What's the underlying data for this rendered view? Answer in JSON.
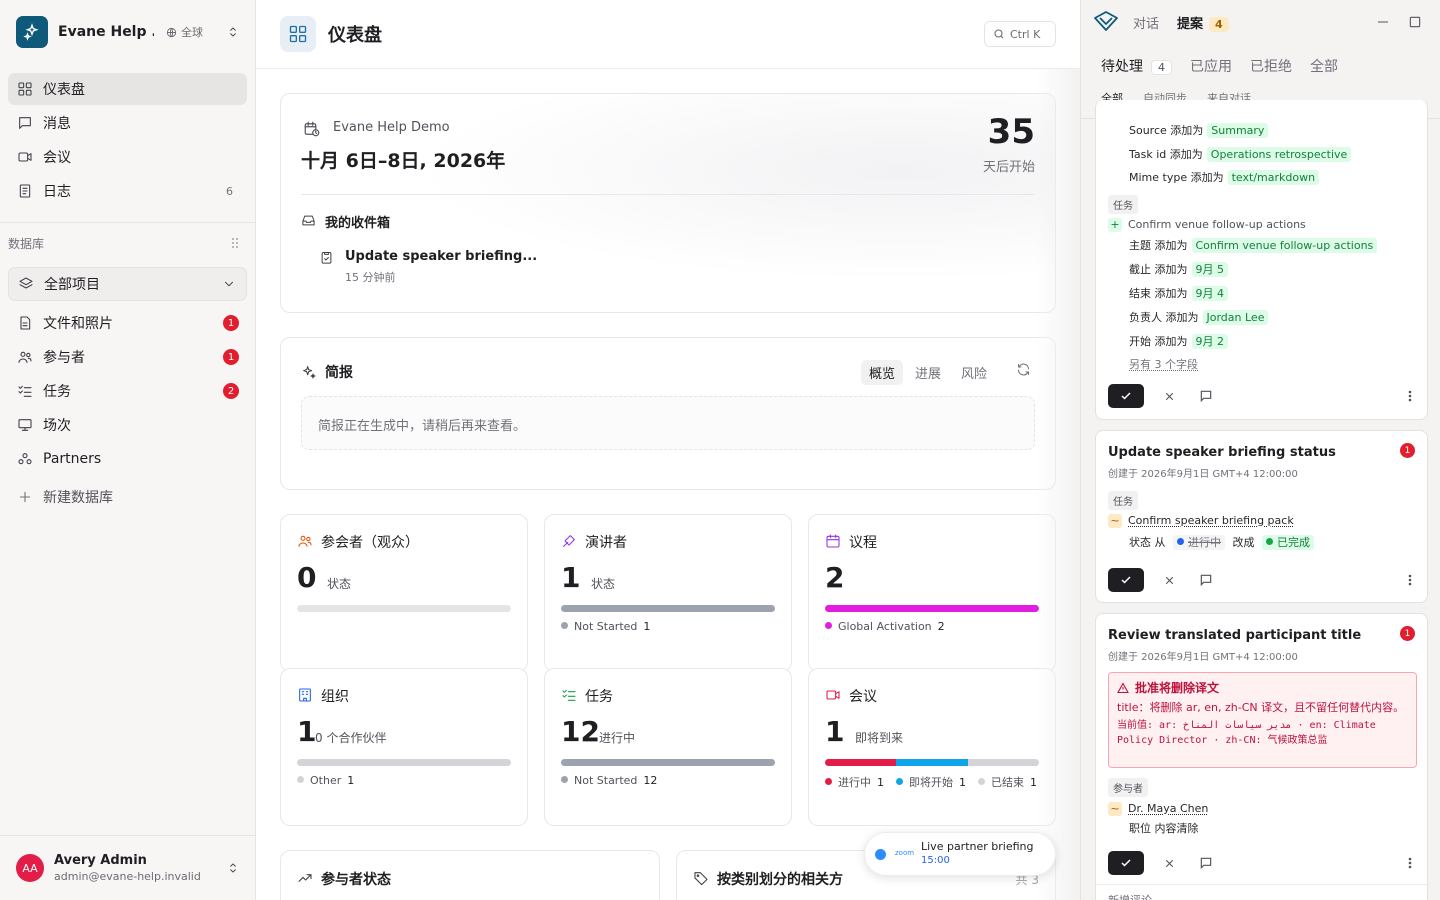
{
  "workspace": {
    "name": "Evane Help ...",
    "scope": "全球"
  },
  "nav": [
    {
      "label": "仪表盘"
    },
    {
      "label": "消息"
    },
    {
      "label": "会议"
    },
    {
      "label": "日志",
      "count": "6"
    }
  ],
  "database": {
    "section_title": "数据库",
    "all_projects": "全部项目",
    "items": [
      {
        "label": "文件和照片",
        "badge": "1"
      },
      {
        "label": "参与者",
        "badge": "1"
      },
      {
        "label": "任务",
        "badge": "2"
      },
      {
        "label": "场次"
      },
      {
        "label": "Partners"
      }
    ],
    "new_db": "新建数据库"
  },
  "user": {
    "initials": "AA",
    "name": "Avery Admin",
    "email": "admin@evane-help.invalid"
  },
  "page": {
    "title": "仪表盘",
    "search_hint": "Ctrl K"
  },
  "event": {
    "name": "Evane Help Demo",
    "dates": "十月 6日–8日, 2026年",
    "days_count": "35",
    "days_label": "天后开始",
    "inbox_title": "我的收件箱",
    "inbox_item": "Update speaker briefing...",
    "inbox_time": "15 分钟前"
  },
  "briefing": {
    "title": "简报",
    "tabs": [
      "概览",
      "进展",
      "风险"
    ],
    "message": "简报正在生成中，请稍后再来查看。"
  },
  "stats": [
    {
      "title": "参会者（观众）",
      "value": "0",
      "sub": "状态",
      "color": "#ea580c",
      "legend": []
    },
    {
      "title": "演讲者",
      "value": "1",
      "sub": "状态",
      "color": "#9333ea",
      "legend": [
        {
          "label": "Not Started",
          "count": "1",
          "color": "#9ca3af"
        }
      ]
    },
    {
      "title": "议程",
      "value": "2",
      "sub": "",
      "color": "#9333ea",
      "legend": [
        {
          "label": "Global Activation",
          "count": "2",
          "color": "#e11de0"
        }
      ]
    },
    {
      "title": "组织",
      "value": "1",
      "sub": "0 个合作伙伴",
      "color": "#2563eb",
      "legend": [
        {
          "label": "Other",
          "count": "1",
          "color": "#d4d4d8"
        }
      ]
    },
    {
      "title": "任务",
      "value": "12",
      "sub": "进行中",
      "color": "#16a34a",
      "legend": [
        {
          "label": "Not Started",
          "count": "12",
          "color": "#9ca3af"
        }
      ]
    },
    {
      "title": "会议",
      "value": "1",
      "sub": "即将到来",
      "color": "#e11d48",
      "legend": [
        {
          "label": "进行中",
          "count": "1",
          "color": "#e11d48"
        },
        {
          "label": "即将开始",
          "count": "1",
          "color": "#0ea5e9"
        },
        {
          "label": "已结束",
          "count": "1",
          "color": "#d4d4d8"
        }
      ]
    }
  ],
  "bottom_cards": {
    "participant_status": "参与者状态",
    "stakeholders": "按类别划分的相关方",
    "stakeholders_count": "共 3"
  },
  "toast": {
    "brand": "zoom",
    "title": "Live partner briefing",
    "time": "15:00"
  },
  "panel": {
    "tabs": [
      "对话",
      "提案"
    ],
    "proposals_count": "4",
    "status_tabs": [
      "待处理",
      "已应用",
      "已拒绝",
      "全部"
    ],
    "pending_count": "4",
    "filters": [
      "全部",
      "自动同步",
      "来自对话"
    ],
    "card1": {
      "fields": [
        {
          "key": "Source 添加为",
          "val": "Summary"
        },
        {
          "key": "Task id 添加为",
          "val": "Operations retrospective"
        },
        {
          "key": "Mime type 添加为",
          "val": "text/markdown"
        }
      ],
      "tag": "任务",
      "item": "Confirm venue follow-up actions",
      "subfields": [
        {
          "key": "主题 添加为",
          "val": "Confirm venue follow-up actions"
        },
        {
          "key": "截止 添加为",
          "val": "9月 5"
        },
        {
          "key": "结束 添加为",
          "val": "9月 4"
        },
        {
          "key": "负责人 添加为",
          "val": "Jordan Lee"
        },
        {
          "key": "开始 添加为",
          "val": "9月 2"
        }
      ],
      "more": "另有 3 个字段"
    },
    "card2": {
      "title": "Update speaker briefing status",
      "badge": "1",
      "meta": "创建于 2026年9月1日 GMT+4 12:00:00",
      "tag": "任务",
      "item": "Confirm speaker briefing pack",
      "change_prefix": "状态 从",
      "from": "进行中",
      "mid": "改成",
      "to": "已完成"
    },
    "card3": {
      "title": "Review translated participant title",
      "badge": "1",
      "meta": "创建于 2026年9月1日 GMT+4 12:00:00",
      "warn_title": "批准将删除译文",
      "warn_body": "title：将删除 ar, en, zh-CN 译文，且不留任何替代内容。",
      "warn_current": "当前值: ar: مدير سياسات المناخ · en: Climate Policy Director · zh-CN: 气候政策总监",
      "tag": "参与者",
      "item": "Dr. Maya Chen",
      "change": "职位 内容清除",
      "add_comment": "新增评论"
    }
  }
}
